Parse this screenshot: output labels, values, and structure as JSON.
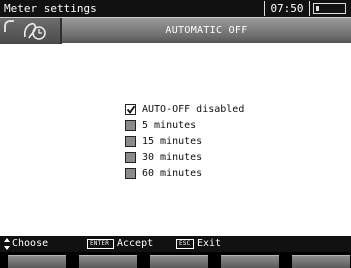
{
  "statusbar": {
    "title": "Meter settings",
    "time": "07:50"
  },
  "header": {
    "title": "AUTOMATIC OFF",
    "icon": "meter-clock-icon"
  },
  "options": [
    {
      "label": "AUTO-OFF disabled",
      "checked": true
    },
    {
      "label": "5 minutes",
      "checked": false
    },
    {
      "label": "15 minutes",
      "checked": false
    },
    {
      "label": "30 minutes",
      "checked": false
    },
    {
      "label": "60 minutes",
      "checked": false
    }
  ],
  "footer": {
    "choose": "Choose",
    "enter_key": "ENTER",
    "accept": "Accept",
    "esc_key": "ESC",
    "exit": "Exit"
  },
  "softkeys": [
    "",
    "",
    "",
    "",
    ""
  ],
  "colors": {
    "background": "#000000",
    "panel": "#ffffff",
    "tab": "#7a7a7a",
    "text": "#111111"
  }
}
